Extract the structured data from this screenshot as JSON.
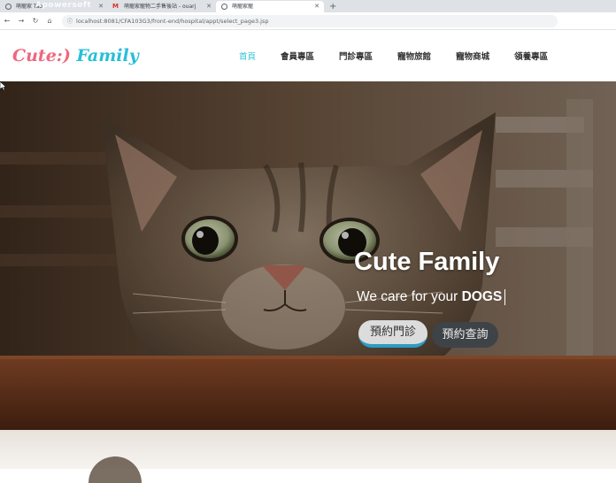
{
  "browser": {
    "tabs": [
      {
        "title": "萌寵家 Tab",
        "favicon": "globe-icon",
        "active": false
      },
      {
        "title": "萌寵家寵物二手售後站 - ouarj",
        "favicon": "gmail-icon",
        "active": false
      },
      {
        "title": "萌寵家寵",
        "favicon": "globe-icon",
        "active": true
      }
    ],
    "new_tab": "+",
    "url": "localhost:8081/CFA103G3/front-end/hospital/appt/select_page3.jsp",
    "watermark": "Apowersoft"
  },
  "site": {
    "logo_part1": "Cute:)",
    "logo_part2": "Family",
    "nav": [
      "首頁",
      "會員專區",
      "門診專區",
      "寵物旅館",
      "寵物商城",
      "領養專區"
    ]
  },
  "hero": {
    "title": "Cute Family",
    "tagline_prefix": "We care for your",
    "tagline_highlight": "DOGS",
    "primary_button": "預約門診",
    "secondary_button": "預約查詢"
  },
  "colors": {
    "accent": "#2ec3d9",
    "logo_pink": "#f0667e",
    "logo_cyan": "#27bfd8",
    "button_underline": "#2d9cc4"
  }
}
